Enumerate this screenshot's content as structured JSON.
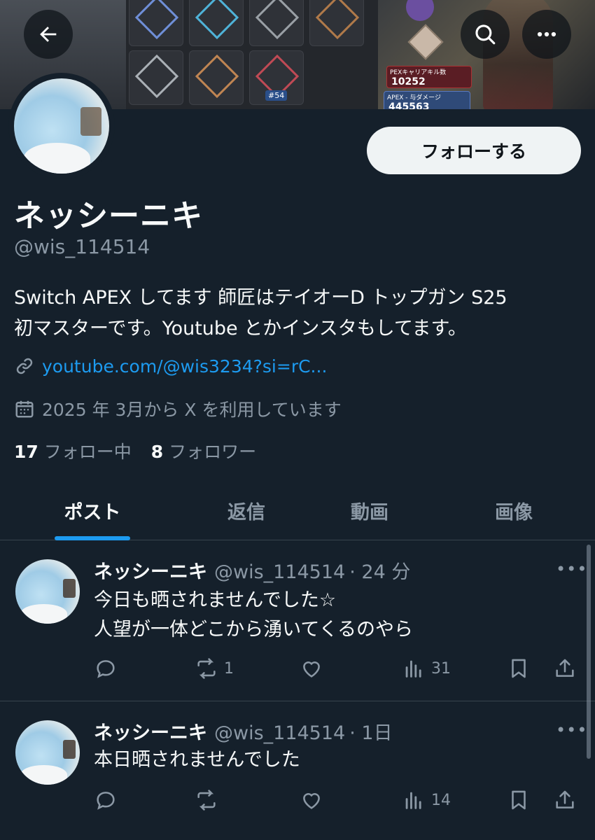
{
  "colors": {
    "background": "#15202b",
    "accent": "#1d9bf0",
    "muted": "#8b98a5",
    "text": "#f7f9f9"
  },
  "banner": {
    "rank_label_1": "PEXキャリアキル数",
    "rank_value_1": "10252",
    "rank_label_2": "APEX - 与ダメージ",
    "rank_value_2": "445563",
    "badge_number": "#54"
  },
  "topbar": {
    "back_icon": "arrow-left-icon",
    "search_icon": "search-icon",
    "more_icon": "more-icon"
  },
  "profile": {
    "follow_label": "フォローする",
    "display_name": "ネッシーニキ",
    "handle": "@wis_114514",
    "bio_line1": "Switch APEX してます 師匠はテイオーD トップガン S25",
    "bio_line2": "初マスターです。Youtube とかインスタもしてます。",
    "link": "youtube.com/@wis3234?si=rC...",
    "joined": "2025 年 3月から X を利用しています",
    "following_count": "17",
    "following_label": "フォロー中",
    "followers_count": "8",
    "followers_label": "フォロワー"
  },
  "tabs": [
    {
      "label": "ポスト",
      "active": true
    },
    {
      "label": "返信",
      "active": false
    },
    {
      "label": "動画",
      "active": false
    },
    {
      "label": "画像",
      "active": false
    }
  ],
  "posts": [
    {
      "name": "ネッシーニキ",
      "handle": "@wis_114514",
      "time": "· 24 分",
      "line1": "今日も晒されませんでした☆",
      "line2": "人望が一体どこから湧いてくるのやら",
      "retweets": "1",
      "views": "31"
    },
    {
      "name": "ネッシーニキ",
      "handle": "@wis_114514",
      "time": "· 1日",
      "line1": "本日晒されませんでした",
      "line2": "",
      "retweets": "",
      "views": "14"
    }
  ],
  "more_glyph": "•••"
}
